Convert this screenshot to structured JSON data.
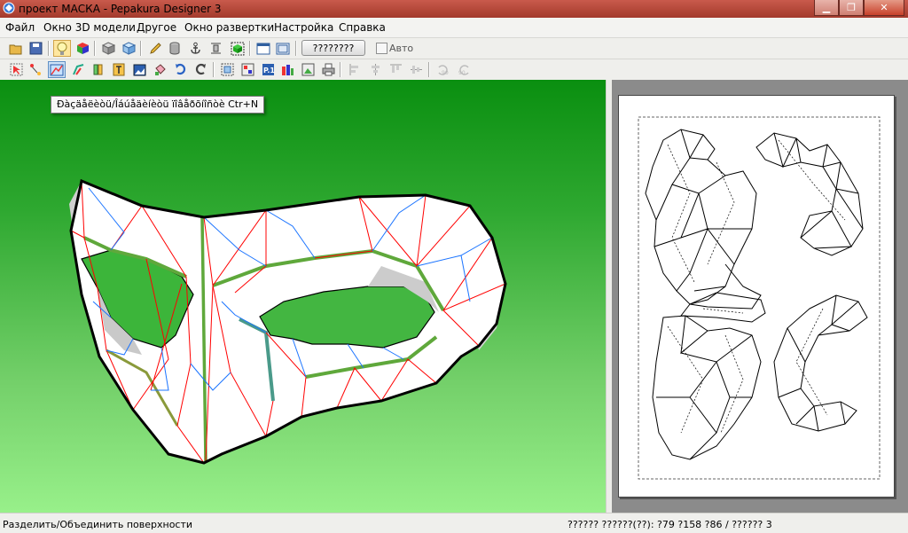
{
  "window": {
    "title": "проект МАСКА - Pepakura Designer 3"
  },
  "menu": [
    "Файл",
    "Окно 3D модели",
    "Другое",
    "Окно развертки",
    "Настройка",
    "Справка"
  ],
  "toolbar": {
    "run_button_label": "????????",
    "auto_checkbox_label": "Авто",
    "auto_checked": false
  },
  "tooltip": {
    "text": "Ðàçäåëèòü/Îáúåäèíèòü ïîâåðõíîñòè Ctr+N"
  },
  "status": {
    "left": "Разделить/Объединить поверхности",
    "right": "?????? ??????(??): ?79 ?158 ?86 / ?????? 3"
  },
  "colors": {
    "viewport_top": "#0a8f10",
    "viewport_bottom": "#98f08a",
    "cut_line": "#ff0000",
    "fold_line": "#1b74ff",
    "flap": "#5fa83b",
    "title_bar": "#b24738"
  }
}
